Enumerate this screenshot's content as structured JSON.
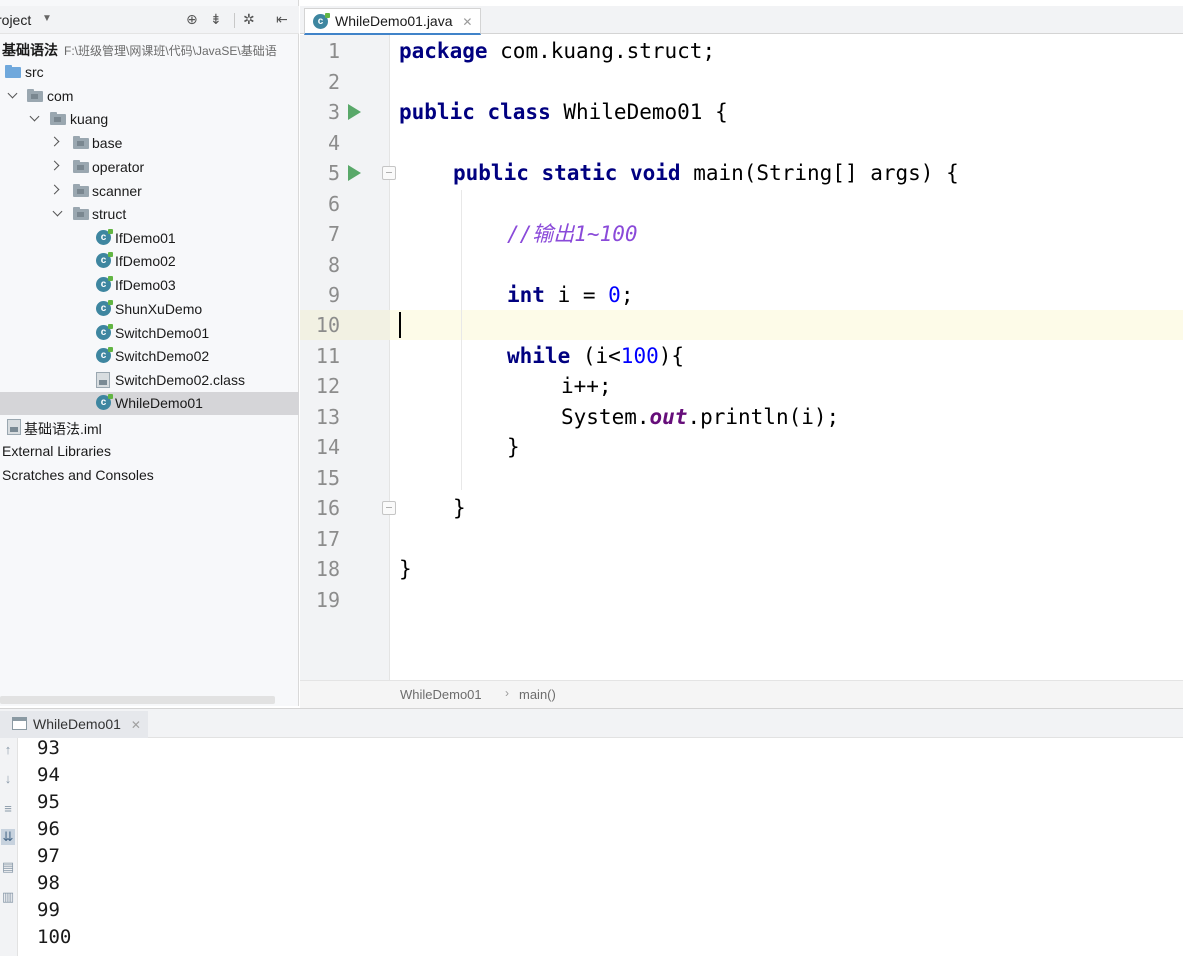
{
  "project_panel": {
    "title": "roject",
    "tree": [
      {
        "name": "tree-root",
        "label": "基础语法",
        "path": "F:\\班级管理\\网课班\\代码\\JavaSE\\基础语",
        "kind": "root"
      },
      {
        "name": "tree-folder-src",
        "label": "src",
        "kind": "folder-src"
      },
      {
        "name": "tree-package-com",
        "label": "com",
        "kind": "package",
        "expanded": true
      },
      {
        "name": "tree-package-kuang",
        "label": "kuang",
        "kind": "package",
        "expanded": true
      },
      {
        "name": "tree-package-base",
        "label": "base",
        "kind": "package",
        "expanded": false
      },
      {
        "name": "tree-package-operator",
        "label": "operator",
        "kind": "package",
        "expanded": false
      },
      {
        "name": "tree-package-scanner",
        "label": "scanner",
        "kind": "package",
        "expanded": false
      },
      {
        "name": "tree-package-struct",
        "label": "struct",
        "kind": "package",
        "expanded": true
      },
      {
        "name": "tree-class-ifdemo01",
        "label": "IfDemo01",
        "kind": "class"
      },
      {
        "name": "tree-class-ifdemo02",
        "label": "IfDemo02",
        "kind": "class"
      },
      {
        "name": "tree-class-ifdemo03",
        "label": "IfDemo03",
        "kind": "class"
      },
      {
        "name": "tree-class-shunxudemo",
        "label": "ShunXuDemo",
        "kind": "class"
      },
      {
        "name": "tree-class-switchdemo01",
        "label": "SwitchDemo01",
        "kind": "class"
      },
      {
        "name": "tree-class-switchdemo02",
        "label": "SwitchDemo02",
        "kind": "class"
      },
      {
        "name": "tree-file-switchdemo02-class",
        "label": "SwitchDemo02.class",
        "kind": "binary"
      },
      {
        "name": "tree-class-whiledemo01",
        "label": "WhileDemo01",
        "kind": "class",
        "selected": true
      },
      {
        "name": "tree-file-iml",
        "label": "基础语法.iml",
        "kind": "iml"
      },
      {
        "name": "tree-external-libraries",
        "label": "External Libraries",
        "kind": "plain"
      },
      {
        "name": "tree-scratches",
        "label": "Scratches and Consoles",
        "kind": "plain"
      }
    ]
  },
  "editor": {
    "tab_label": "WhileDemo01.java",
    "class_icon_letter": "c",
    "line_numbers": [
      "1",
      "2",
      "3",
      "4",
      "5",
      "6",
      "7",
      "8",
      "9",
      "10",
      "11",
      "12",
      "13",
      "14",
      "15",
      "16",
      "17",
      "18",
      "19"
    ],
    "code": {
      "l1_kw": "package",
      "l1_rest": " com.kuang.struct;",
      "l3_kw": "public class",
      "l3_rest": " WhileDemo01 {",
      "l5_kw": "public static void",
      "l5_rest": " main(String[] args) {",
      "l7_comment": "//输出1~100",
      "l9_kw": "int",
      "l9_mid": " i = ",
      "l9_num": "0",
      "l9_end": ";",
      "l11_kw": "while",
      "l11_mid": " (i<",
      "l11_num": "100",
      "l11_end": "){",
      "l12": "i++;",
      "l13_a": "System.",
      "l13_field": "out",
      "l13_b": ".println(i);",
      "l14": "}",
      "l16": "}",
      "l18": "}"
    },
    "breadcrumb": [
      "WhileDemo01",
      "main()"
    ]
  },
  "run": {
    "tab_label": "WhileDemo01",
    "output": [
      "93",
      "94",
      "95",
      "96",
      "97",
      "98",
      "99",
      "100"
    ]
  },
  "icons": {
    "run_gutter": "play-icon",
    "fold": "fold-icon",
    "console_tools": [
      "arrow-up-icon",
      "arrow-down-icon",
      "soft-wrap-icon",
      "scroll-to-end-icon",
      "print-icon",
      "trash-icon"
    ]
  },
  "colors": {
    "keyword": "#000080",
    "number": "#0000ff",
    "comment": "#8a4ad9",
    "static_field": "#660e7a",
    "current_line": "#fdfbe8",
    "run_icon": "#59a869"
  }
}
